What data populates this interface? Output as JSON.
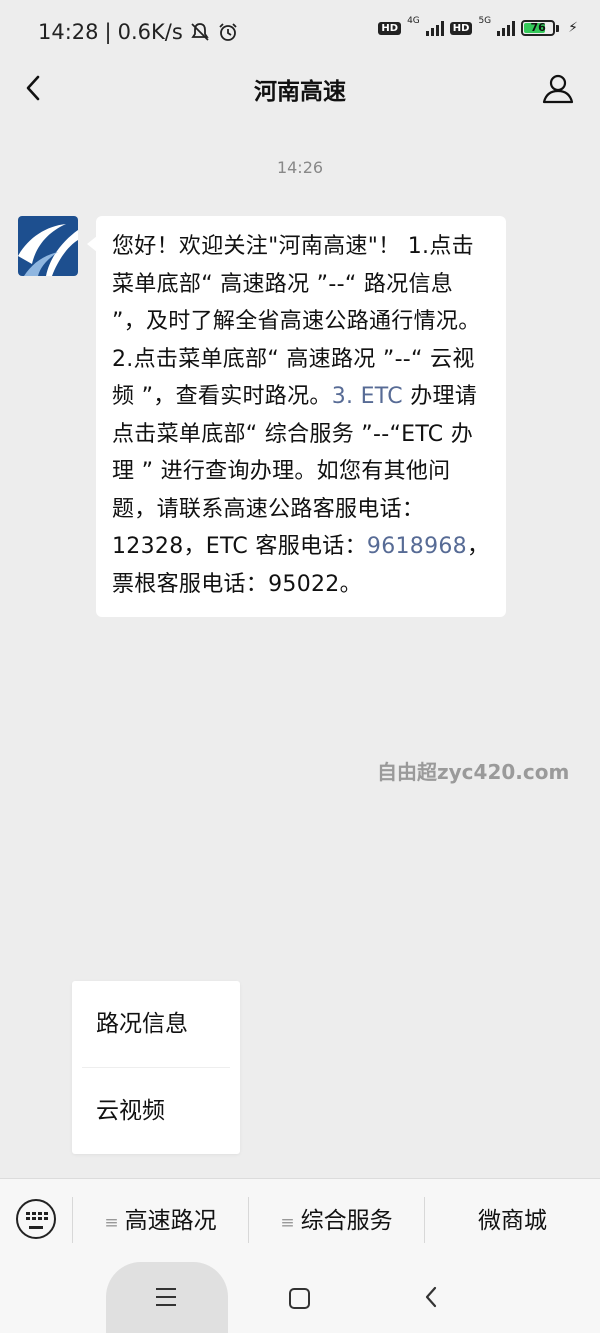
{
  "status_bar": {
    "time": "14:28",
    "separator": "|",
    "network_speed": "0.6K/s",
    "hd_label": "HD",
    "sim1_network": "4G",
    "sim2_network": "5G",
    "battery_level": "76",
    "battery_fraction": 0.76
  },
  "header": {
    "title": "河南高速"
  },
  "chat": {
    "timestamp": "14:26",
    "message": {
      "part1": "您好！欢迎关注\"河南高速\"！ 1.点击菜单底部“ 高速路况 ”--“ 路况信息 ”，及时了解全省高速公路通行情况。2.点击菜单底部“ 高速路况 ”--“ 云视频 ”，查看实时路况。",
      "link1": "3. ETC",
      "part2": " 办理请点击菜单底部“ 综合服务 ”--“ETC 办理 ” 进行查询办理。如您有其他问题，请联系高速公路客服电话：12328，ETC 客服电话：",
      "phone_link": "9618968",
      "part3": "，票根客服电话：95022。"
    }
  },
  "watermark": "自由超zyc420.com",
  "submenu": {
    "items": [
      "路况信息",
      "云视频"
    ]
  },
  "menu_bar": {
    "menu_icon": "≡",
    "items": [
      "高速路况",
      "综合服务",
      "微商城"
    ]
  },
  "colors": {
    "background": "#ededed",
    "link": "#576b95",
    "bubble": "#ffffff",
    "battery": "#35c95a"
  },
  "icons": [
    "back-arrow-icon",
    "profile-icon",
    "keyboard-icon",
    "menu-lines-icon",
    "nav-recents-icon",
    "nav-home-icon",
    "nav-back-icon",
    "mute-icon",
    "alarm-icon",
    "signal-icon",
    "battery-icon",
    "charging-icon"
  ]
}
